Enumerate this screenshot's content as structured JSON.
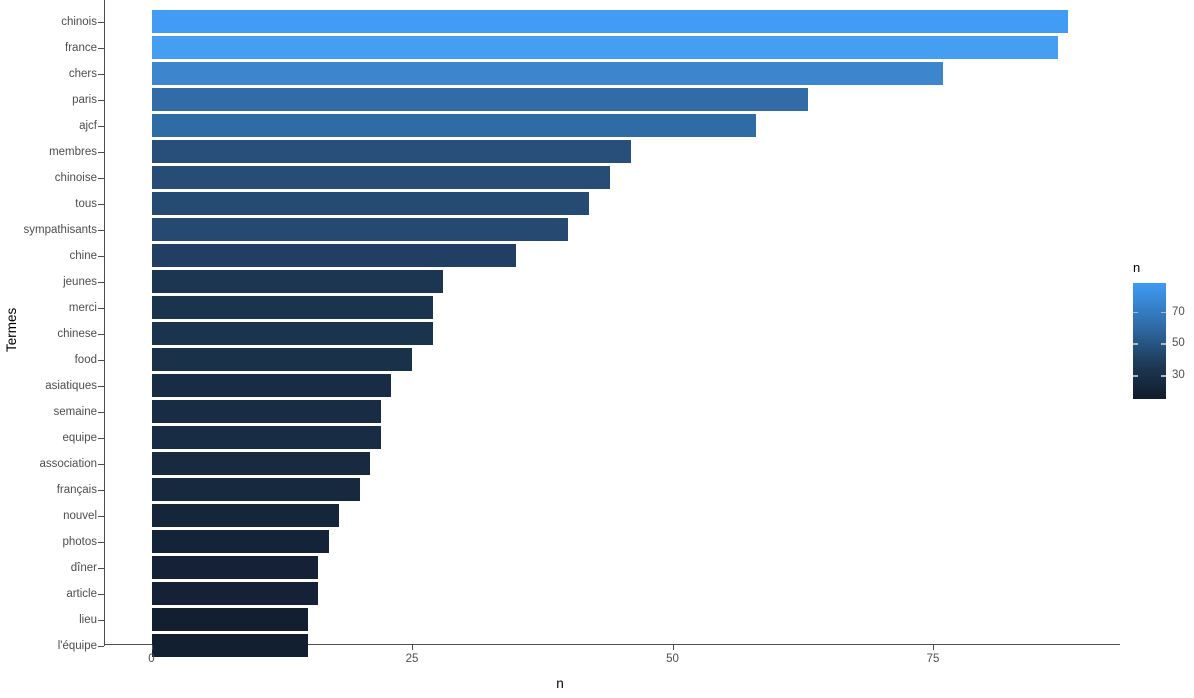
{
  "chart_data": {
    "type": "bar",
    "orientation": "horizontal",
    "title": "",
    "xlabel": "n",
    "ylabel": "Termes",
    "xlim": [
      0,
      88
    ],
    "ylim": null,
    "grid": false,
    "legend": {
      "position": "right",
      "title": "n",
      "type": "continuous-colorbar",
      "ticks": [
        70,
        50,
        30
      ],
      "tick_labels": [
        "70",
        "50",
        "30"
      ],
      "gradient_high_color": "#3f9bf5",
      "gradient_low_color": "#111c2b",
      "range": [
        15,
        88
      ]
    },
    "x_ticks": [
      0,
      25,
      50,
      75
    ],
    "x_tick_labels": [
      "0",
      "25",
      "50",
      "75"
    ],
    "categories": [
      "chinois",
      "france",
      "chers",
      "paris",
      "ajcf",
      "membres",
      "chinoise",
      "tous",
      "sympathisants",
      "chine",
      "jeunes",
      "merci",
      "chinese",
      "food",
      "asiatiques",
      "semaine",
      "equipe",
      "association",
      "français",
      "nouvel",
      "photos",
      "dîner",
      "article",
      "lieu",
      "l'équipe"
    ],
    "values": [
      88,
      87,
      76,
      63,
      58,
      46,
      44,
      42,
      40,
      35,
      28,
      27,
      27,
      25,
      23,
      22,
      22,
      21,
      20,
      18,
      17,
      16,
      16,
      15,
      15
    ],
    "bar_colors": [
      "#419cf5",
      "#459ef2",
      "#3d86ce",
      "#316ca8",
      "#2f6ba5",
      "#284f79",
      "#274d77",
      "#264b73",
      "#254971",
      "#203f62",
      "#1c3550",
      "#1b344e",
      "#1b344e",
      "#1a314a",
      "#182d45",
      "#182c43",
      "#182c43",
      "#172a40",
      "#17293e",
      "#15253a",
      "#142338",
      "#142136",
      "#142136",
      "#121f31",
      "#121f31"
    ]
  },
  "axes": {
    "y_title": "Termes",
    "x_title": "n"
  }
}
